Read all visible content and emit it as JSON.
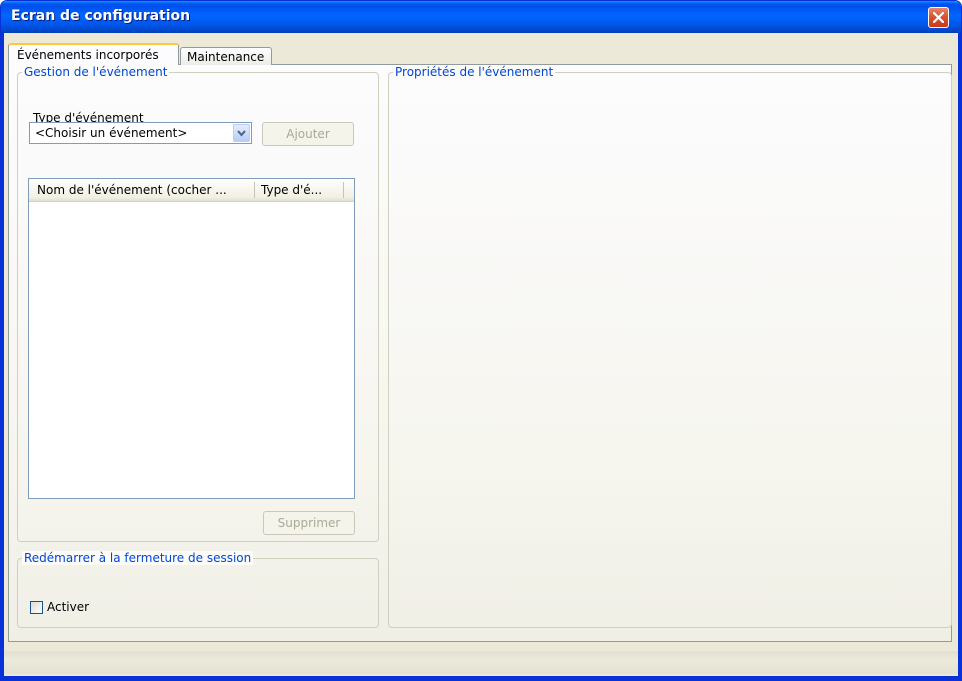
{
  "window": {
    "title": "Ecran de configuration"
  },
  "tabs": [
    {
      "label": "Événements incorporés",
      "active": true
    },
    {
      "label": "Maintenance",
      "active": false
    }
  ],
  "event_group": {
    "legend": "Gestion de l'événement",
    "type_label": "Type d'événement",
    "combo_value": "<Choisir un événement>",
    "add_button": "Ajouter",
    "columns": [
      "Nom de l'événement (cocher ...",
      "Type d'é..."
    ],
    "delete_button": "Supprimer"
  },
  "properties_group": {
    "legend": "Propriétés de l'événement"
  },
  "restart_group": {
    "legend": "Redémarrer à la fermeture de session",
    "checkbox_label": "Activer",
    "checked": false
  },
  "colors": {
    "title_bar": "#0055ea",
    "group_legend": "#0046d5",
    "active_tab_highlight": "#ffc83c",
    "close_button": "#d8512c"
  },
  "icons": {
    "close": "close-icon",
    "dropdown": "chevron-down-icon"
  }
}
